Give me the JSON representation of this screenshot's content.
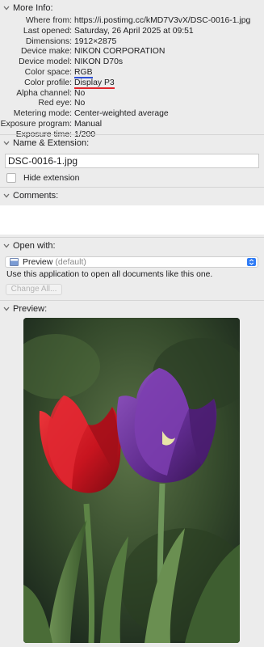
{
  "more_info": {
    "title": "More Info:",
    "rows": [
      {
        "label": "Where from:",
        "value": "https://i.postimg.cc/kMD7V3vX/DSC-0016-1.jpg"
      },
      {
        "label": "Last opened:",
        "value": "Saturday, 26 April 2025 at 09:51"
      },
      {
        "label": "Dimensions:",
        "value": "1912×2875"
      },
      {
        "label": "Device make:",
        "value": "NIKON CORPORATION"
      },
      {
        "label": "Device model:",
        "value": "NIKON D70s"
      },
      {
        "label": "Color space:",
        "value": "RGB"
      },
      {
        "label": "Color profile:",
        "value": "Display P3"
      },
      {
        "label": "Alpha channel:",
        "value": "No"
      },
      {
        "label": "Red eye:",
        "value": "No"
      },
      {
        "label": "Metering mode:",
        "value": "Center-weighted average"
      },
      {
        "label": "Exposure program:",
        "value": "Manual"
      },
      {
        "label": "Exposure time:",
        "value": "1/200"
      }
    ],
    "annotations": {
      "color_space_underline": "#2e4fd6",
      "color_profile_underline": "#e0262b"
    }
  },
  "name_extension": {
    "title": "Name & Extension:",
    "filename": "DSC-0016-1.jpg",
    "hide_extension_label": "Hide extension",
    "hide_extension_checked": false
  },
  "comments": {
    "title": "Comments:",
    "value": ""
  },
  "open_with": {
    "title": "Open with:",
    "app_name": "Preview",
    "app_default": "(default)",
    "app_icon": "preview-app-icon",
    "use_text": "Use this application to open all documents like this one.",
    "change_all_label": "Change All..."
  },
  "preview": {
    "title": "Preview:",
    "image_icon": "tulip-photo"
  },
  "colors": {
    "accent": "#2f7cf6",
    "background": "#ececec",
    "red_tulip": "#d81e2c",
    "purple_tulip": "#6b2f9a"
  }
}
